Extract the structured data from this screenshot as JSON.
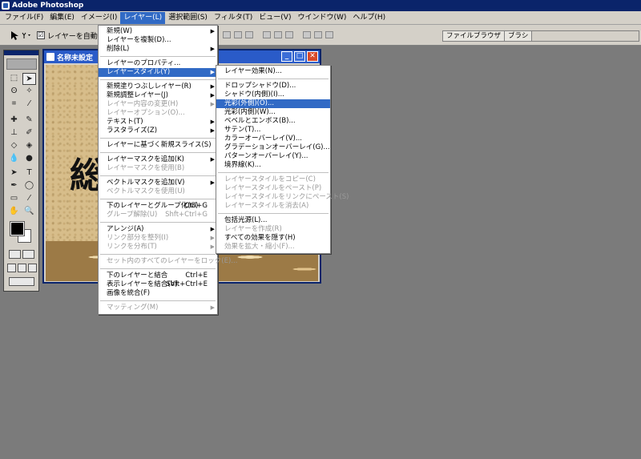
{
  "app": {
    "title": "Adobe Photoshop"
  },
  "menubar": [
    {
      "label": "ファイル(F)",
      "active": false
    },
    {
      "label": "編集(E)",
      "active": false
    },
    {
      "label": "イメージ(I)",
      "active": false
    },
    {
      "label": "レイヤー(L)",
      "active": true
    },
    {
      "label": "選択範囲(S)",
      "active": false
    },
    {
      "label": "フィルタ(T)",
      "active": false
    },
    {
      "label": "ビュー(V)",
      "active": false
    },
    {
      "label": "ウインドウ(W)",
      "active": false
    },
    {
      "label": "ヘルプ(H)",
      "active": false
    }
  ],
  "options_bar": {
    "auto_select_label": "レイヤーを自動選択",
    "auto_select_checked": "☑"
  },
  "palette_well": {
    "tabs": [
      "ファイルブラウザ",
      "ブラシ"
    ]
  },
  "document": {
    "title": "名称未設定",
    "visible_text": "総"
  },
  "layer_menu": {
    "items": [
      {
        "label": "新規(W)",
        "arrow": true
      },
      {
        "label": "レイヤーを複製(D)..."
      },
      {
        "label": "削除(L)",
        "arrow": true
      },
      {
        "sep": true
      },
      {
        "label": "レイヤーのプロパティ..."
      },
      {
        "label": "レイヤースタイル(Y)",
        "arrow": true,
        "hl": true
      },
      {
        "sep": true
      },
      {
        "label": "新規塗りつぶしレイヤー(R)",
        "arrow": true
      },
      {
        "label": "新規調整レイヤー(J)",
        "arrow": true
      },
      {
        "label": "レイヤー内容の変更(H)",
        "arrow": true,
        "dis": true
      },
      {
        "label": "レイヤーオプション(O)...",
        "dis": true
      },
      {
        "label": "テキスト(T)",
        "arrow": true
      },
      {
        "label": "ラスタライズ(Z)",
        "arrow": true
      },
      {
        "sep": true
      },
      {
        "label": "レイヤーに基づく新規スライス(S)"
      },
      {
        "sep": true
      },
      {
        "label": "レイヤーマスクを追加(K)",
        "arrow": true
      },
      {
        "label": "レイヤーマスクを使用(B)",
        "dis": true
      },
      {
        "sep": true
      },
      {
        "label": "ベクトルマスクを追加(V)",
        "arrow": true
      },
      {
        "label": "ベクトルマスクを使用(U)",
        "dis": true
      },
      {
        "sep": true
      },
      {
        "label": "下のレイヤーとグループ化(G)",
        "shortcut": "Ctrl+G"
      },
      {
        "label": "グループ解除(U)",
        "shortcut": "Shft+Ctrl+G",
        "dis": true
      },
      {
        "sep": true
      },
      {
        "label": "アレンジ(A)",
        "arrow": true
      },
      {
        "label": "リンク部分を整列(I)",
        "arrow": true,
        "dis": true
      },
      {
        "label": "リンクを分布(T)",
        "arrow": true,
        "dis": true
      },
      {
        "sep": true
      },
      {
        "label": "セット内のすべてのレイヤーをロック(E)...",
        "dis": true
      },
      {
        "sep": true
      },
      {
        "label": "下のレイヤーと結合",
        "shortcut": "Ctrl+E"
      },
      {
        "label": "表示レイヤーを結合(V)",
        "shortcut": "Shft+Ctrl+E"
      },
      {
        "label": "画像を統合(F)"
      },
      {
        "sep": true
      },
      {
        "label": "マッティング(M)",
        "arrow": true,
        "dis": true
      }
    ]
  },
  "style_submenu": {
    "items": [
      {
        "label": "レイヤー効果(N)..."
      },
      {
        "sep": true
      },
      {
        "label": "ドロップシャドウ(D)..."
      },
      {
        "label": "シャドウ(内側)(I)..."
      },
      {
        "label": "光彩(外側)(O)...",
        "hl": true
      },
      {
        "label": "光彩(内側)(W)..."
      },
      {
        "label": "ベベルとエンボス(B)..."
      },
      {
        "label": "サテン(T)..."
      },
      {
        "label": "カラーオーバーレイ(V)..."
      },
      {
        "label": "グラデーションオーバーレイ(G)..."
      },
      {
        "label": "パターンオーバーレイ(Y)..."
      },
      {
        "label": "境界線(K)..."
      },
      {
        "sep": true
      },
      {
        "label": "レイヤースタイルをコピー(C)",
        "dis": true
      },
      {
        "label": "レイヤースタイルをペースト(P)",
        "dis": true
      },
      {
        "label": "レイヤースタイルをリンクにペースト(S)",
        "dis": true
      },
      {
        "label": "レイヤースタイルを消去(A)",
        "dis": true
      },
      {
        "sep": true
      },
      {
        "label": "包括光源(L)..."
      },
      {
        "label": "レイヤーを作成(R)",
        "dis": true
      },
      {
        "label": "すべての効果を隠す(H)"
      },
      {
        "label": "効果を拡大・縮小(F)...",
        "dis": true
      }
    ]
  }
}
